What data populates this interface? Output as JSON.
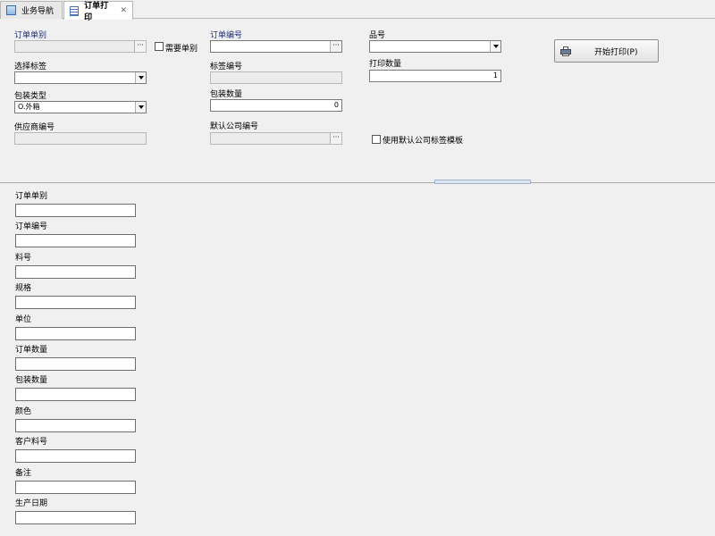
{
  "tabs": [
    {
      "label": "业务导航",
      "active": false
    },
    {
      "label": "订单打印",
      "active": true,
      "close": "✕"
    }
  ],
  "top": {
    "order_type_label": "订单单别",
    "need_order_type_label": "需要单别",
    "order_no_label": "订单编号",
    "part_no_label": "品号",
    "select_label_label": "选择标签",
    "label_no_label": "标签编号",
    "print_qty_label": "打印数量",
    "print_qty_value": "1",
    "pack_type_label": "包装类型",
    "pack_type_value": "O.外箱",
    "pack_qty_label": "包装数量",
    "pack_qty_value": "0",
    "supplier_no_label": "供应商编号",
    "default_company_label": "默认公司编号",
    "use_default_template_label": "使用默认公司标签模板",
    "print_button_label": "开始打印(P)",
    "ellipsis": "···"
  },
  "bottom_fields": [
    {
      "label": "订单单别"
    },
    {
      "label": "订单编号"
    },
    {
      "label": "料号"
    },
    {
      "label": "规格"
    },
    {
      "label": "单位"
    },
    {
      "label": "订单数量"
    },
    {
      "label": "包装数量"
    },
    {
      "label": "颜色"
    },
    {
      "label": "客户料号"
    },
    {
      "label": "备注"
    },
    {
      "label": "生产日期"
    }
  ]
}
